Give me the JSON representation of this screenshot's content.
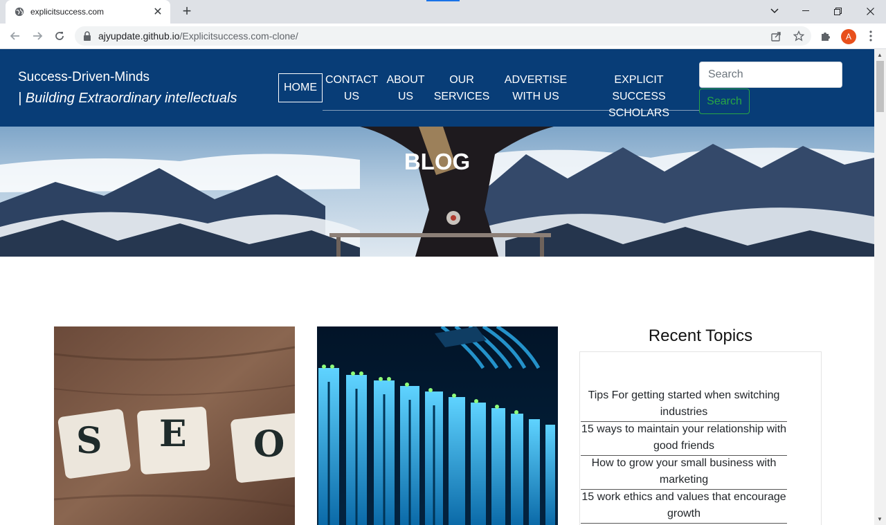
{
  "browser": {
    "tab_title": "explicitsuccess.com",
    "tab_close": "✕",
    "new_tab": "+",
    "url_host": "ajyupdate.github.io",
    "url_path": "/Explicitsuccess.com-clone/",
    "avatar_letter": "A"
  },
  "header": {
    "brand": "Success-Driven-Minds",
    "tagline": "| Building Extraordinary intellectuals",
    "nav": {
      "home": "HOME",
      "contact_1": "CONTACT",
      "contact_2": "US",
      "about_1": "ABOUT",
      "about_2": "US",
      "services_1": "OUR",
      "services_2": "SERVICES",
      "advertise_1": "ADVERTISE",
      "advertise_2": "WITH US",
      "scholars_1": "EXPLICIT SUCCESS",
      "scholars_2": "SCHOLARS"
    },
    "search_placeholder": "Search",
    "search_button": "Search"
  },
  "hero": {
    "title": "BLOG"
  },
  "sidebar": {
    "heading": "Recent Topics",
    "topics": [
      "Tips For getting started when switching industries",
      "15 ways to maintain your relationship with good friends",
      "How to grow your small business with marketing",
      "15 work ethics and values that encourage growth"
    ]
  },
  "cards": {
    "seo_letters": [
      "S",
      "E",
      "O"
    ]
  },
  "colors": {
    "header_bg": "#083d77",
    "search_green": "#28a745",
    "chrome_bg": "#dee1e6"
  }
}
